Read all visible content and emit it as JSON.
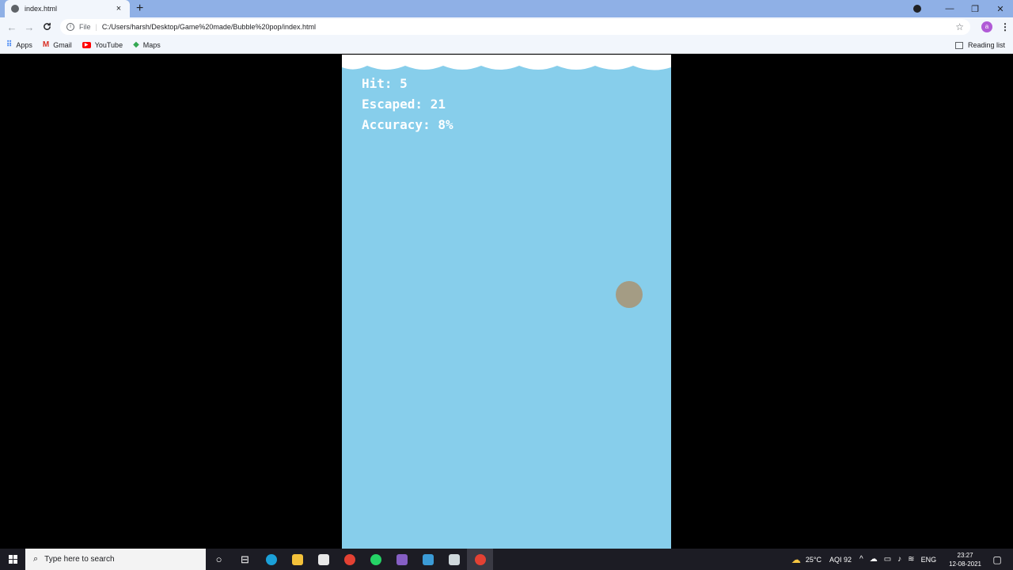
{
  "browser": {
    "tab_title": "index.html",
    "tab_close": "×",
    "new_tab": "+",
    "window_controls": {
      "minimize": "—",
      "restore": "❐",
      "close": "✕"
    },
    "nav": {
      "back": "←",
      "forward": "→",
      "reload": "C"
    },
    "omnibox": {
      "scheme_label": "File",
      "url": "C:/Users/harsh/Desktop/Game%20made/Bubble%20pop/index.html"
    },
    "profile_initial": "a",
    "menu": "⋮",
    "bookmarks": [
      {
        "label": "Apps",
        "icon": "apps-icon"
      },
      {
        "label": "Gmail",
        "icon": "gmail-icon"
      },
      {
        "label": "YouTube",
        "icon": "youtube-icon"
      },
      {
        "label": "Maps",
        "icon": "maps-icon"
      }
    ],
    "reading_list": "Reading list"
  },
  "game": {
    "hit_label": "Hit:",
    "hit_value": "5",
    "escaped_label": "Escaped:",
    "escaped_value": "21",
    "accuracy_label": "Accuracy:",
    "accuracy_value": "8%",
    "background_color": "#87ceeb",
    "bubble_color": "#a49c84"
  },
  "taskbar": {
    "search_placeholder": "Type here to search",
    "weather": "25°C",
    "aqi": "AQI 92",
    "language": "ENG",
    "time": "23:27",
    "date": "12-08-2021"
  }
}
